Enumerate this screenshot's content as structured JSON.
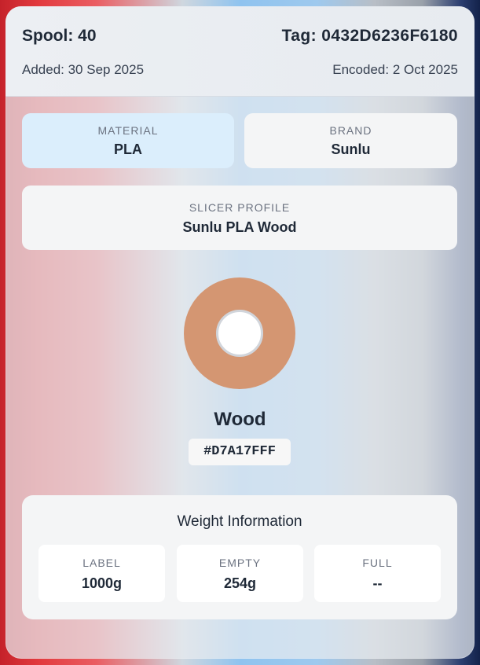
{
  "header": {
    "spool": "Spool: 40",
    "tag": "Tag: 0432D6236F6180",
    "added": "Added: 30 Sep 2025",
    "encoded": "Encoded: 2 Oct 2025"
  },
  "material": {
    "label": "MATERIAL",
    "value": "PLA"
  },
  "brand": {
    "label": "BRAND",
    "value": "Sunlu"
  },
  "slicer": {
    "label": "SLICER PROFILE",
    "value": "Sunlu PLA Wood"
  },
  "color": {
    "name": "Wood",
    "hex": "#D7A17FFF",
    "swatch": "#d49672"
  },
  "weight": {
    "title": "Weight Information",
    "cells": [
      {
        "label": "LABEL",
        "value": "1000g"
      },
      {
        "label": "EMPTY",
        "value": "254g"
      },
      {
        "label": "FULL",
        "value": "--"
      }
    ]
  }
}
